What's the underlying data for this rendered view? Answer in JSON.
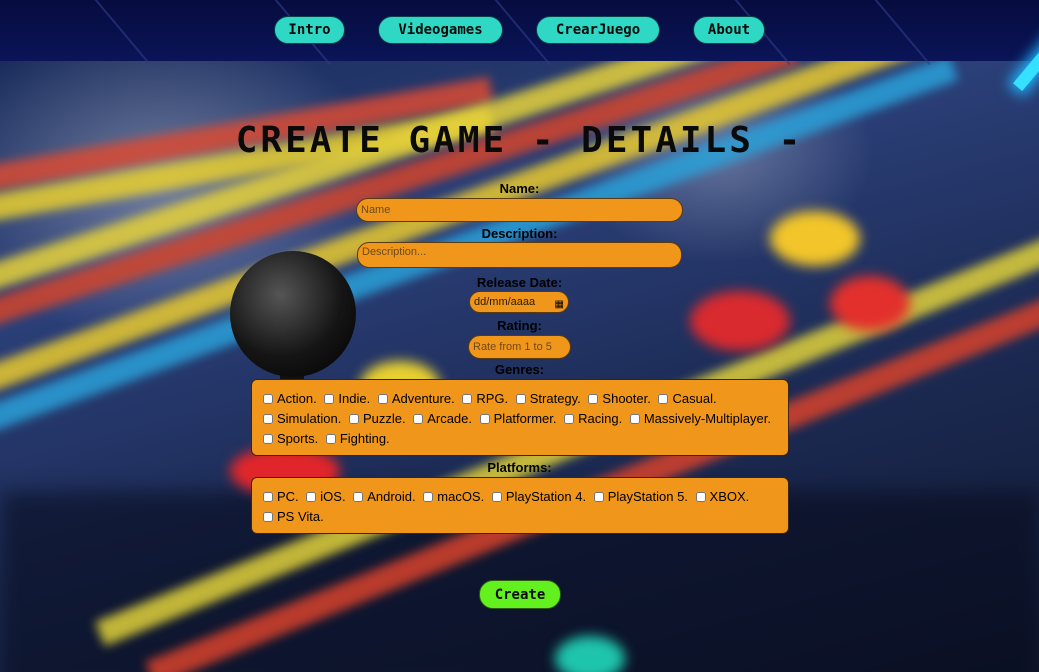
{
  "nav": {
    "items": [
      {
        "label": "Intro"
      },
      {
        "label": "Videogames"
      },
      {
        "label": "CrearJuego"
      },
      {
        "label": "About"
      }
    ]
  },
  "form": {
    "title": "CREATE GAME - DETAILS -",
    "name": {
      "label": "Name:",
      "placeholder": "Name",
      "value": ""
    },
    "description": {
      "label": "Description:",
      "placeholder": "Description...",
      "value": ""
    },
    "release_date": {
      "label": "Release Date:",
      "display": "dd/mm/aaaa"
    },
    "rating": {
      "label": "Rating:",
      "placeholder": "Rate from 1 to 5",
      "value": ""
    },
    "genres": {
      "label": "Genres:",
      "options": [
        "Action.",
        "Indie.",
        "Adventure.",
        "RPG.",
        "Strategy.",
        "Shooter.",
        "Casual.",
        "Simulation.",
        "Puzzle.",
        "Arcade.",
        "Platformer.",
        "Racing.",
        "Massively-Multiplayer.",
        "Sports.",
        "Fighting."
      ]
    },
    "platforms": {
      "label": "Platforms:",
      "options": [
        "PC.",
        "iOS.",
        "Android.",
        "macOS.",
        "PlayStation 4.",
        "PlayStation 5.",
        "XBOX.",
        "PS Vita."
      ]
    },
    "submit_label": "Create"
  },
  "colors": {
    "nav_button": "#2fd8c4",
    "field": "#f0961b",
    "create_button": "#62f11f",
    "nav_bar": "#070c3f"
  }
}
